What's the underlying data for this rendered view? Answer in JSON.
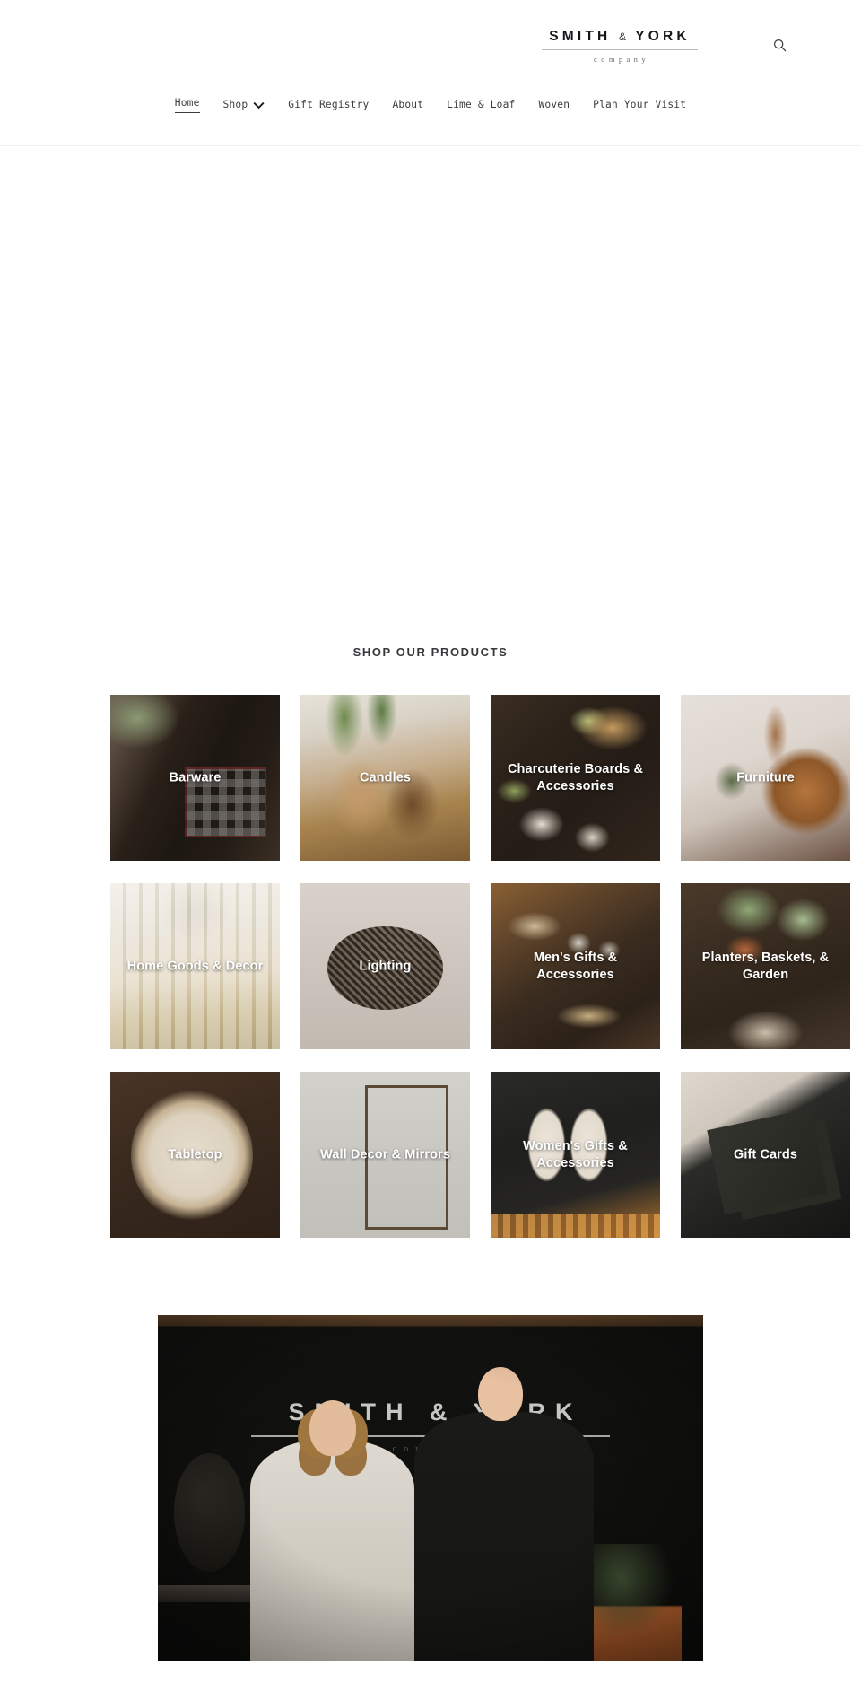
{
  "header": {
    "logo": {
      "word_left": "SMITH",
      "amp": "&",
      "word_right": "YORK",
      "subtitle": "company"
    },
    "search_icon_name": "search-icon",
    "nav": [
      {
        "label": "Home",
        "active": true,
        "has_dropdown": false
      },
      {
        "label": "Shop",
        "active": false,
        "has_dropdown": true
      },
      {
        "label": "Gift Registry",
        "active": false,
        "has_dropdown": false
      },
      {
        "label": "About",
        "active": false,
        "has_dropdown": false
      },
      {
        "label": "Lime & Loaf",
        "active": false,
        "has_dropdown": false
      },
      {
        "label": "Woven",
        "active": false,
        "has_dropdown": false
      },
      {
        "label": "Plan Your Visit",
        "active": false,
        "has_dropdown": false
      }
    ]
  },
  "products": {
    "title": "SHOP OUR PRODUCTS",
    "tiles": [
      {
        "label": "Barware"
      },
      {
        "label": "Candles"
      },
      {
        "label": "Charcuterie Boards & Accessories"
      },
      {
        "label": "Furniture"
      },
      {
        "label": "Home Goods & Decor"
      },
      {
        "label": "Lighting"
      },
      {
        "label": "Men's Gifts & Accessories"
      },
      {
        "label": "Planters, Baskets, & Garden"
      },
      {
        "label": "Tabletop"
      },
      {
        "label": "Wall Decor & Mirrors"
      },
      {
        "label": "Women's Gifts & Accessories"
      },
      {
        "label": "Gift Cards"
      }
    ]
  },
  "founders_photo": {
    "sign_word_left": "SMITH",
    "sign_amp": "&",
    "sign_word_right": "YORK",
    "sign_subtitle": "company"
  },
  "colors": {
    "text_dark": "#15161a",
    "nav_text": "#3c3c3e",
    "tile_label": "#ffffff",
    "header_border": "#efefef",
    "page_background": "#ffffff"
  }
}
